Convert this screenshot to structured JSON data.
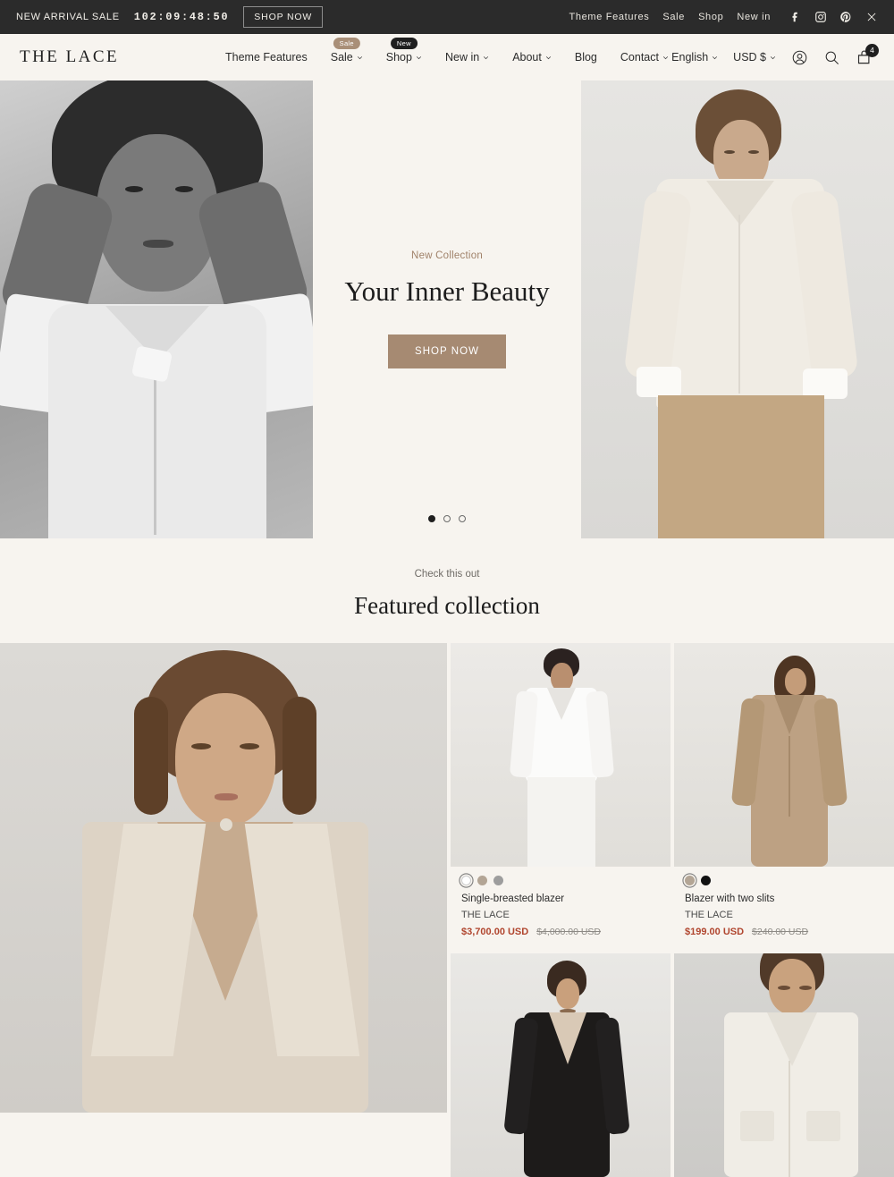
{
  "announcement": {
    "label": "NEW ARRIVAL SALE",
    "timer": "102:09:48:50",
    "button": "SHOP NOW",
    "links": [
      "Theme Features",
      "Sale",
      "Shop",
      "New in"
    ],
    "social": [
      "facebook-icon",
      "instagram-icon",
      "pinterest-icon"
    ],
    "close": "close-icon",
    "bg": "#2b2b2b"
  },
  "header": {
    "logo": "THE LACE",
    "nav": [
      {
        "label": "Theme Features",
        "caret": false,
        "badge": null
      },
      {
        "label": "Sale",
        "caret": true,
        "badge": "Sale",
        "badge_style": "sale"
      },
      {
        "label": "Shop",
        "caret": true,
        "badge": "New",
        "badge_style": "new"
      },
      {
        "label": "New in",
        "caret": true,
        "badge": null
      },
      {
        "label": "About",
        "caret": true,
        "badge": null
      },
      {
        "label": "Blog",
        "caret": false,
        "badge": null
      },
      {
        "label": "Contact",
        "caret": true,
        "badge": null
      }
    ],
    "language": "English",
    "currency": "USD $",
    "account_icon": "account-icon",
    "search_icon": "search-icon",
    "cart_icon": "cart-icon",
    "cart_count": "4"
  },
  "hero": {
    "eyebrow": "New Collection",
    "title": "Your Inner Beauty",
    "cta": "SHOP NOW",
    "cta_color": "#a68a72",
    "slides": 3,
    "active_slide": 1
  },
  "featured": {
    "eyebrow": "Check this out",
    "title": "Featured collection"
  },
  "products": [
    {
      "title": "Single-breasted blazer",
      "vendor": "THE LACE",
      "price": "$3,700.00 USD",
      "compare_at": "$4,000.00 USD",
      "swatches": [
        "#ffffff",
        "#b3a595",
        "#9d9d9d"
      ],
      "selected_swatch": 0
    },
    {
      "title": "Blazer with two slits",
      "vendor": "THE LACE",
      "price": "$199.00 USD",
      "compare_at": "$240.00 USD",
      "swatches": [
        "#b3a595",
        "#111111"
      ],
      "selected_swatch": 0
    }
  ],
  "colors": {
    "page_bg": "#f7f4ef",
    "accent": "#a68a72",
    "sale_price": "#b0452e"
  }
}
